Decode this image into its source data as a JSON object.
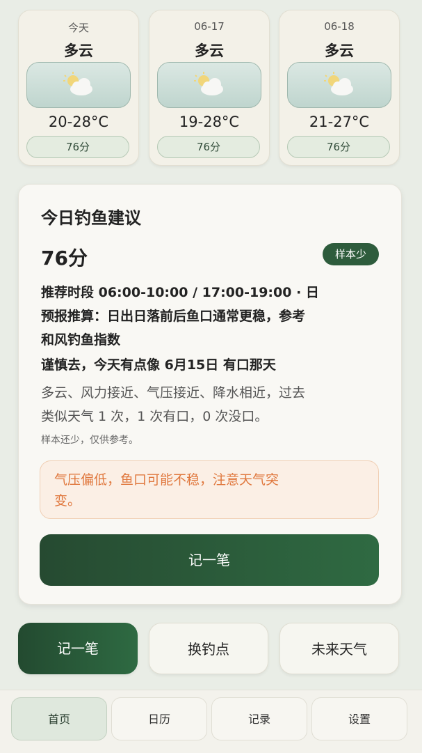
{
  "forecast": [
    {
      "date": "今天",
      "condition": "多云",
      "temp": "20-28°C",
      "score": "76分"
    },
    {
      "date": "06-17",
      "condition": "多云",
      "temp": "19-28°C",
      "score": "76分"
    },
    {
      "date": "06-18",
      "condition": "多云",
      "temp": "21-27°C",
      "score": "76分"
    }
  ],
  "advice": {
    "title": "今日钓鱼建议",
    "score": "76分",
    "badge": "样本少",
    "recommend_line1": "推荐时段 06:00-10:00 / 17:00-19:00 · 日",
    "recommend_line2": "预报推算：日出日落前后鱼口通常更稳，参考",
    "recommend_line3": "和风钓鱼指数",
    "similar_title": "谨慎去，今天有点像 6月15日 有口那天",
    "similar_line1": "多云、风力接近、气压接近、降水相近，过去",
    "similar_line2": "类似天气 1 次，1 次有口，0 次没口。",
    "sample_note": "样本还少，仅供参考。",
    "warning_line1": "气压偏低，鱼口可能不稳，注意天气突",
    "warning_line2": "变。",
    "record_button": "记一笔"
  },
  "quick_actions": [
    "记一笔",
    "换钓点",
    "未来天气"
  ],
  "tabs": [
    "首页",
    "日历",
    "记录",
    "设置"
  ],
  "icons": {
    "weather": "partly-cloudy-icon"
  },
  "colors": {
    "accent": "#2e5c3c",
    "warning": "#e0783e"
  }
}
